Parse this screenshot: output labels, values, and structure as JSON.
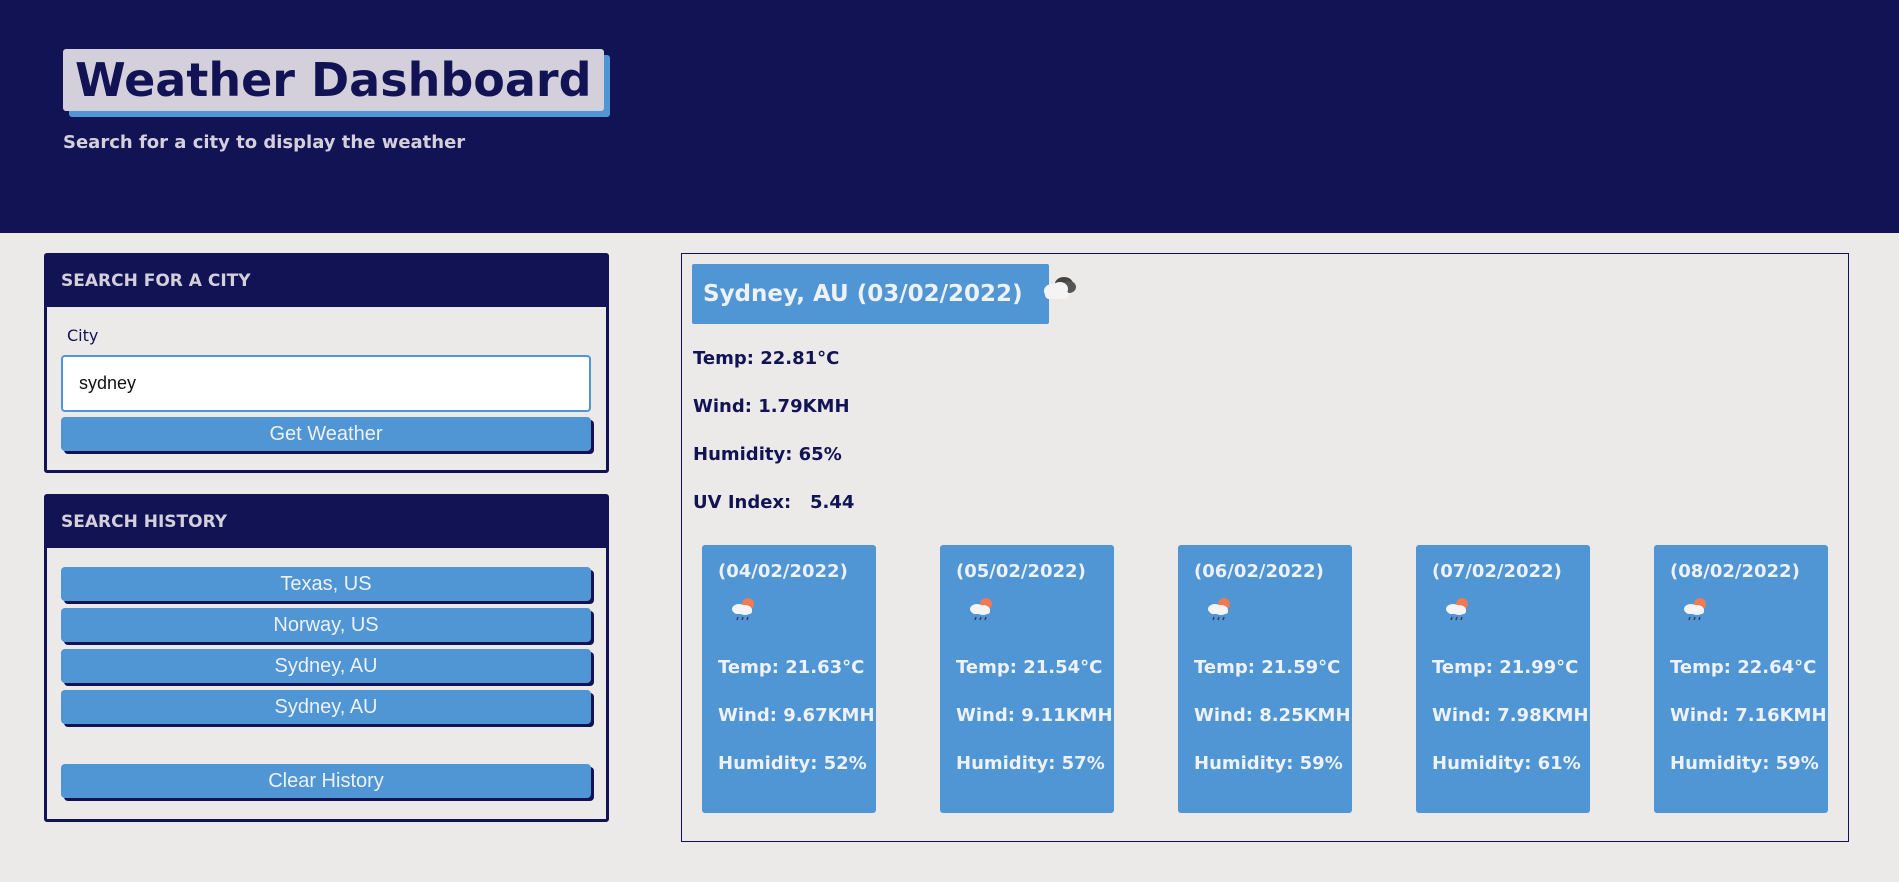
{
  "header": {
    "title": "Weather Dashboard",
    "subtitle": "Search for a city to display the weather"
  },
  "search": {
    "heading": "SEARCH FOR A CITY",
    "label": "City",
    "value": "sydney",
    "button": "Get Weather"
  },
  "history": {
    "heading": "SEARCH HISTORY",
    "items": [
      "Texas, US",
      "Norway, US",
      "Sydney, AU",
      "Sydney, AU"
    ],
    "clear_button": "Clear History"
  },
  "current": {
    "title": "Sydney, AU (03/02/2022)",
    "icon": "cloudy-icon",
    "temp": "Temp: 22.81°C",
    "wind": "Wind: 1.79KMH",
    "humidity": "Humidity: 65%",
    "uv": "UV Index:   5.44"
  },
  "forecast": [
    {
      "date": "(04/02/2022)",
      "icon": "rain-sun-icon",
      "temp": "Temp: 21.63°C",
      "wind": "Wind: 9.67KMH",
      "humidity": "Humidity: 52%"
    },
    {
      "date": "(05/02/2022)",
      "icon": "rain-sun-icon",
      "temp": "Temp: 21.54°C",
      "wind": "Wind: 9.11KMH",
      "humidity": "Humidity: 57%"
    },
    {
      "date": "(06/02/2022)",
      "icon": "rain-sun-icon",
      "temp": "Temp: 21.59°C",
      "wind": "Wind: 8.25KMH",
      "humidity": "Humidity: 59%"
    },
    {
      "date": "(07/02/2022)",
      "icon": "rain-sun-icon",
      "temp": "Temp: 21.99°C",
      "wind": "Wind: 7.98KMH",
      "humidity": "Humidity: 61%"
    },
    {
      "date": "(08/02/2022)",
      "icon": "rain-sun-icon",
      "temp": "Temp: 22.64°C",
      "wind": "Wind: 7.16KMH",
      "humidity": "Humidity: 59%"
    }
  ],
  "colors": {
    "navy": "#111354",
    "accent": "#5095d4",
    "background": "#ebeae9",
    "light": "#d3d0dc"
  }
}
